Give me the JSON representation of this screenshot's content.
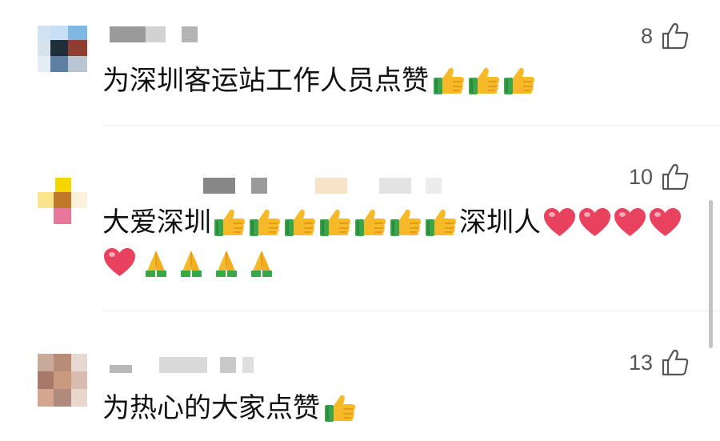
{
  "comments": [
    {
      "likes": "8",
      "text_before": "为深圳客运站工作人员点赞",
      "thumbs": 3
    },
    {
      "likes": "10",
      "line1_a": "大爱深圳",
      "thumbs_a": 7,
      "line1_b": "深圳人",
      "hearts_line1": 4,
      "hearts_line2": 1,
      "prays": 4
    },
    {
      "likes": "13",
      "text_before": "为热心的大家点赞",
      "thumbs": 1
    }
  ],
  "icons": {
    "like": "thumbs-up-outline-icon",
    "thumbs": "thumbs-up-emoji-icon",
    "heart": "heart-emoji-icon",
    "pray": "folded-hands-emoji-icon"
  },
  "colors": {
    "like_count": "#555555",
    "text": "#111111",
    "divider": "#ececec",
    "thumb_yellow": "#f6b928",
    "sleeve_green": "#3aa54a",
    "heart_pink": "#e8425f"
  }
}
